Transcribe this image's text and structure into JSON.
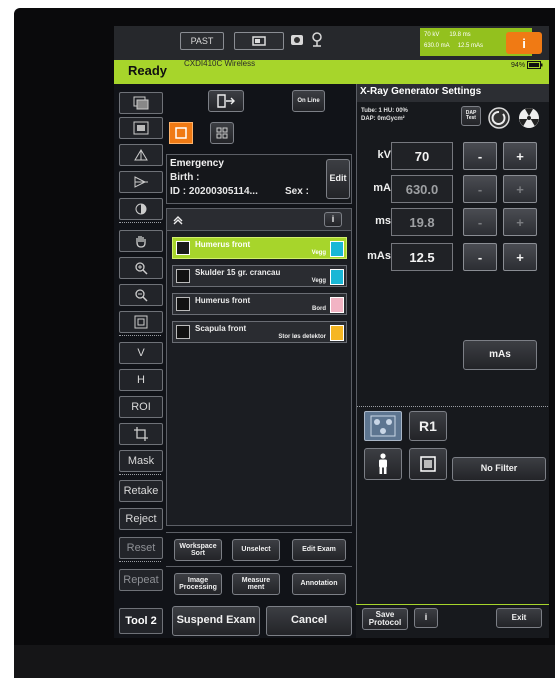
{
  "topbar": {
    "past_label": "PAST",
    "dose": {
      "kv": "70 kV",
      "ms": "19.8 ms",
      "ma": "630.0 mA",
      "mas": "12.5 mAs"
    },
    "info_label": "i"
  },
  "status": {
    "state": "Ready",
    "device": "CXDI410C Wireless",
    "battery": "94%"
  },
  "sidebar": {
    "text_buttons": [
      "V",
      "H",
      "ROI",
      "Mask",
      "Retake",
      "Reject",
      "Reset",
      "Repeat"
    ],
    "tool2_label": "Tool 2"
  },
  "center": {
    "online_label": "On Line",
    "patient": {
      "name": "Emergency",
      "birth_label": "Birth :",
      "id_label": "ID : 20200305114...",
      "sex_label": "Sex :",
      "edit_label": "Edit"
    },
    "info_label": "i",
    "protocols": [
      {
        "title": "Humerus front",
        "sub": "Vegg",
        "selected": true
      },
      {
        "title": "Skulder 15 gr. crancau",
        "sub": "Vegg",
        "selected": false
      },
      {
        "title": "Humerus front",
        "sub": "Bord",
        "selected": false
      },
      {
        "title": "Scapula front",
        "sub": "Stor løs detektor",
        "selected": false
      }
    ],
    "actions1": {
      "workspace_sort": "Workspace Sort",
      "unselect": "Unselect",
      "edit_exam": "Edit Exam"
    },
    "actions2": {
      "image_processing": "Image Processing",
      "measurement": "Measure ment",
      "annotation": "Annotation"
    },
    "suspend_label": "Suspend Exam",
    "cancel_label": "Cancel"
  },
  "generator": {
    "title": "X-Ray Generator Settings",
    "tube": "Tube: 1  HU: 00%",
    "dap": "DAP: 0mGycm²",
    "dap_test": "DAP Test",
    "params": [
      {
        "label": "kV",
        "value": "70",
        "active": true
      },
      {
        "label": "mA",
        "value": "630.0",
        "active": false
      },
      {
        "label": "ms",
        "value": "19.8",
        "active": false
      },
      {
        "label": "mAs",
        "value": "12.5",
        "active": true
      }
    ],
    "minus": "-",
    "plus": "+",
    "mas_button": "mAs",
    "r1_label": "R1",
    "filter_label": "No Filter",
    "save_protocol": "Save Protocol",
    "info_label": "i",
    "exit_label": "Exit"
  }
}
